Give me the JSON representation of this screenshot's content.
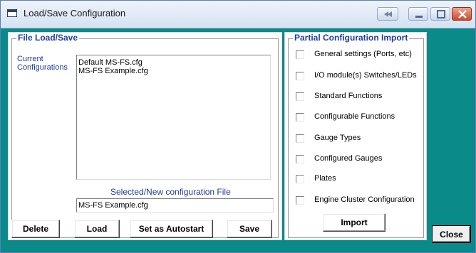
{
  "window": {
    "title": "Load/Save Configuration"
  },
  "file_group": {
    "title": "File Load/Save",
    "current_label_line1": "Current",
    "current_label_line2": "Configurations",
    "configurations": [
      "Default MS-FS.cfg",
      "MS-FS Example.cfg"
    ],
    "selected_label": "Selected/New configuration File",
    "selected_value": "MS-FS Example.cfg",
    "buttons": {
      "delete": "Delete",
      "load": "Load",
      "autostart": "Set as Autostart",
      "save": "Save"
    }
  },
  "import_group": {
    "title": "Partial Configuration Import",
    "options": [
      {
        "label": "General settings (Ports, etc)",
        "checked": false
      },
      {
        "label": "I/O module(s) Switches/LEDs",
        "checked": false
      },
      {
        "label": "Standard Functions",
        "checked": false
      },
      {
        "label": "Configurable Functions",
        "checked": false
      },
      {
        "label": "Gauge Types",
        "checked": false
      },
      {
        "label": "Configured Gauges",
        "checked": false
      },
      {
        "label": "Plates",
        "checked": false
      },
      {
        "label": "Engine Cluster Configuration",
        "checked": false
      }
    ],
    "import_button": "Import"
  },
  "close_button": "Close",
  "colors": {
    "background": "#0b8a8a",
    "group_title": "#1f3c9c"
  }
}
